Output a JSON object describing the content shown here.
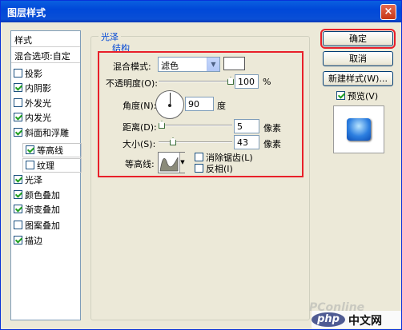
{
  "window": {
    "title": "图层样式",
    "close_glyph": "×"
  },
  "sidebar": {
    "header": "样式",
    "blend_options": "混合选项:自定",
    "items": [
      {
        "label": "投影",
        "checked": false
      },
      {
        "label": "内阴影",
        "checked": true
      },
      {
        "label": "外发光",
        "checked": false
      },
      {
        "label": "内发光",
        "checked": true
      },
      {
        "label": "斜面和浮雕",
        "checked": true
      },
      {
        "label": "等高线",
        "checked": true
      },
      {
        "label": "纹理",
        "checked": false
      },
      {
        "label": "光泽",
        "checked": true,
        "selected": true
      },
      {
        "label": "颜色叠加",
        "checked": true
      },
      {
        "label": "渐变叠加",
        "checked": true
      },
      {
        "label": "图案叠加",
        "checked": false
      },
      {
        "label": "描边",
        "checked": true
      }
    ]
  },
  "panel": {
    "group_title": "光泽",
    "section_title": "结构",
    "blend_mode_label": "混合模式:",
    "blend_mode_value": "滤色",
    "opacity_label": "不透明度(O):",
    "opacity_value": "100",
    "opacity_unit": "%",
    "angle_label": "角度(N):",
    "angle_value": "90",
    "angle_unit": "度",
    "distance_label": "距离(D):",
    "distance_value": "5",
    "distance_unit": "像素",
    "size_label": "大小(S):",
    "size_value": "43",
    "size_unit": "像素",
    "contour_label": "等高线:",
    "antialias_label": "消除锯齿(L)",
    "invert_label": "反相(I)"
  },
  "buttons": {
    "ok": "确定",
    "cancel": "取消",
    "new_style": "新建样式(W)...",
    "preview_label": "预览(V)"
  },
  "watermark": {
    "site": "PConline",
    "php": "php",
    "cn": "中文网"
  }
}
